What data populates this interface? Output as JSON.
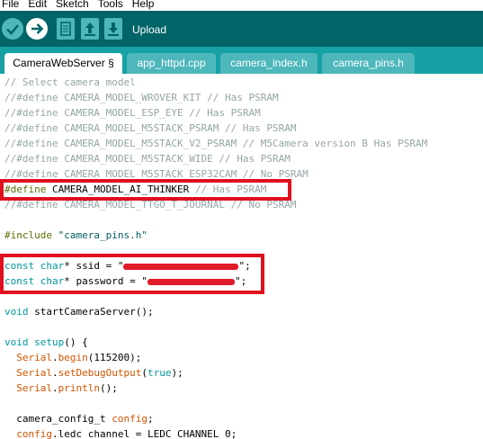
{
  "menu": [
    "File",
    "Edit",
    "Sketch",
    "Tools",
    "Help"
  ],
  "toolbar": {
    "buttons": [
      "verify-icon",
      "upload-icon",
      "new-icon",
      "open-icon",
      "save-icon"
    ],
    "label": "Upload"
  },
  "tabs": [
    {
      "label": "CameraWebServer §",
      "active": true
    },
    {
      "label": "app_httpd.cpp",
      "active": false
    },
    {
      "label": "camera_index.h",
      "active": false
    },
    {
      "label": "camera_pins.h",
      "active": false
    }
  ],
  "code": {
    "l1": "// Select camera model",
    "l2": "//#define CAMERA_MODEL_WROVER_KIT // Has PSRAM",
    "l3": "//#define CAMERA_MODEL_ESP_EYE // Has PSRAM",
    "l4": "//#define CAMERA_MODEL_M5STACK_PSRAM // Has PSRAM",
    "l5": "//#define CAMERA_MODEL_M5STACK_V2_PSRAM // M5Camera version B Has PSRAM",
    "l6": "//#define CAMERA_MODEL_M5STACK_WIDE // Has PSRAM",
    "l7": "//#define CAMERA_MODEL_M5STACK_ESP32CAM // No PSRAM",
    "l8_directive": "#define",
    "l8_rest": " CAMERA_MODEL_AI_THINKER ",
    "l8_comment": "// Has PSRAM",
    "l9": "//#define CAMERA_MODEL_TTGO_T_JOURNAL // No PSRAM",
    "l11_directive": "#include",
    "l11_rest": " \"camera_pins.h\"",
    "l13_type": "const char",
    "l13_rest": "* ssid = \"",
    "l13_end": "\";",
    "l14_type": "const char",
    "l14_rest": "* password = \"",
    "l14_end": "\";",
    "l16_type": "void",
    "l16_rest": " startCameraServer();",
    "l18_type": "void",
    "l18_fn": " setup",
    "l18_rest": "() {",
    "l19_obj": "  Serial",
    "l19_dot": ".",
    "l19_fn": "begin",
    "l19_rest": "(115200);",
    "l20_obj": "  Serial",
    "l20_dot": ".",
    "l20_fn": "setDebugOutput",
    "l20_open": "(",
    "l20_kw": "true",
    "l20_rest": ");",
    "l21_obj": "  Serial",
    "l21_dot": ".",
    "l21_fn": "println",
    "l21_rest": "();",
    "l23_pre": "  camera_config_t ",
    "l23_var": "config",
    "l23_rest": ";",
    "l24_var": "  config",
    "l24_rest": ".ledc_channel = LEDC_CHANNEL_0;"
  }
}
